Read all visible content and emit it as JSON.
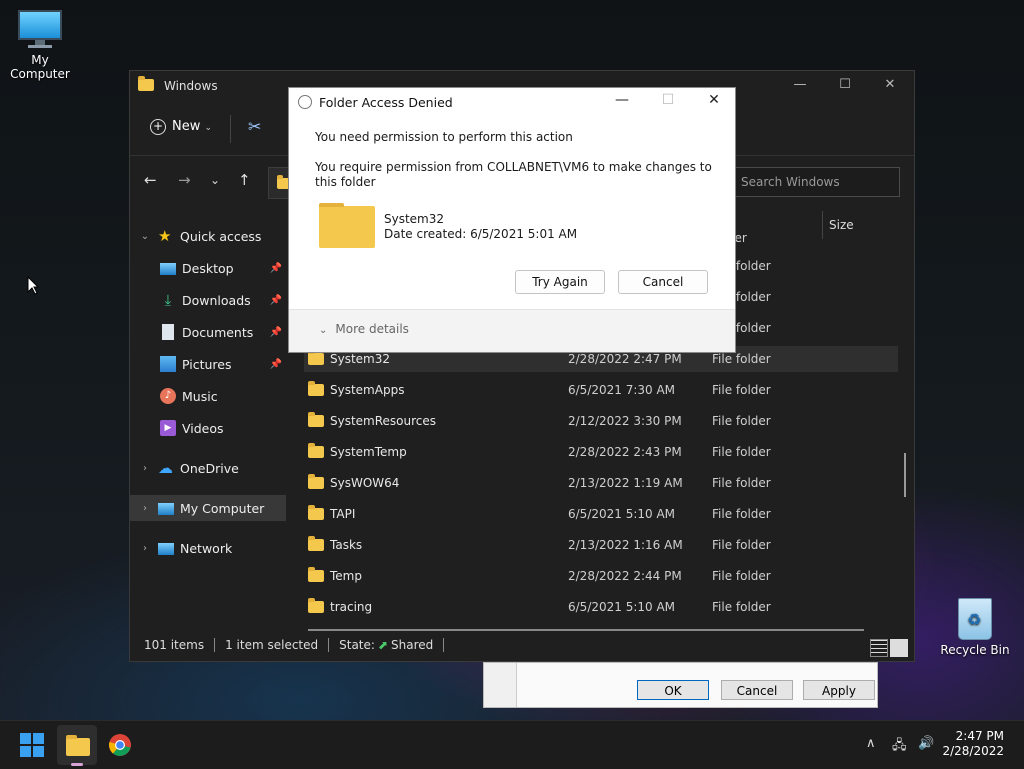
{
  "desktop": {
    "my_computer_label": "My Computer",
    "recycle_bin_label": "Recycle Bin"
  },
  "explorer": {
    "title": "Windows",
    "new_label": "New",
    "search_placeholder": "Search Windows",
    "column_size": "Size",
    "sidebar": [
      {
        "label": "Quick access",
        "icon": "star-icon",
        "level": 0,
        "expanded": true
      },
      {
        "label": "Desktop",
        "icon": "desktop-icon",
        "level": 1,
        "pinned": true
      },
      {
        "label": "Downloads",
        "icon": "download-icon",
        "level": 1,
        "pinned": true
      },
      {
        "label": "Documents",
        "icon": "documents-icon",
        "level": 1,
        "pinned": true
      },
      {
        "label": "Pictures",
        "icon": "pictures-icon",
        "level": 1,
        "pinned": true
      },
      {
        "label": "Music",
        "icon": "music-icon",
        "level": 1
      },
      {
        "label": "Videos",
        "icon": "videos-icon",
        "level": 1
      },
      {
        "label": "OneDrive",
        "icon": "cloud-icon",
        "level": 0
      },
      {
        "label": "My Computer",
        "icon": "computer-icon",
        "level": 0,
        "selected": true
      },
      {
        "label": "Network",
        "icon": "network-icon",
        "level": 0
      }
    ],
    "partial_rows_type": [
      "folder",
      "File folder",
      "File folder",
      "File folder"
    ],
    "files": [
      {
        "name": "System32",
        "date": "2/28/2022 2:47 PM",
        "type": "File folder",
        "selected": true
      },
      {
        "name": "SystemApps",
        "date": "6/5/2021 7:30 AM",
        "type": "File folder"
      },
      {
        "name": "SystemResources",
        "date": "2/12/2022 3:30 PM",
        "type": "File folder"
      },
      {
        "name": "SystemTemp",
        "date": "2/28/2022 2:43 PM",
        "type": "File folder"
      },
      {
        "name": "SysWOW64",
        "date": "2/13/2022 1:19 AM",
        "type": "File folder"
      },
      {
        "name": "TAPI",
        "date": "6/5/2021 5:10 AM",
        "type": "File folder"
      },
      {
        "name": "Tasks",
        "date": "2/13/2022 1:16 AM",
        "type": "File folder"
      },
      {
        "name": "Temp",
        "date": "2/28/2022 2:44 PM",
        "type": "File folder"
      },
      {
        "name": "tracing",
        "date": "6/5/2021 5:10 AM",
        "type": "File folder"
      }
    ],
    "status": {
      "items": "101 items",
      "selected": "1 item selected",
      "state_label": "State:",
      "state_value": "Shared"
    }
  },
  "properties_dialog": {
    "ok": "OK",
    "cancel": "Cancel",
    "apply": "Apply"
  },
  "access_dialog": {
    "title": "Folder Access Denied",
    "message1": "You need permission to perform this action",
    "message2": "You require permission from COLLABNET\\VM6 to make changes to this folder",
    "folder_name": "System32",
    "folder_date": "Date created: 6/5/2021 5:01 AM",
    "try_again": "Try Again",
    "cancel": "Cancel",
    "more_details": "More details"
  },
  "taskbar": {
    "time": "2:47 PM",
    "date": "2/28/2022"
  }
}
